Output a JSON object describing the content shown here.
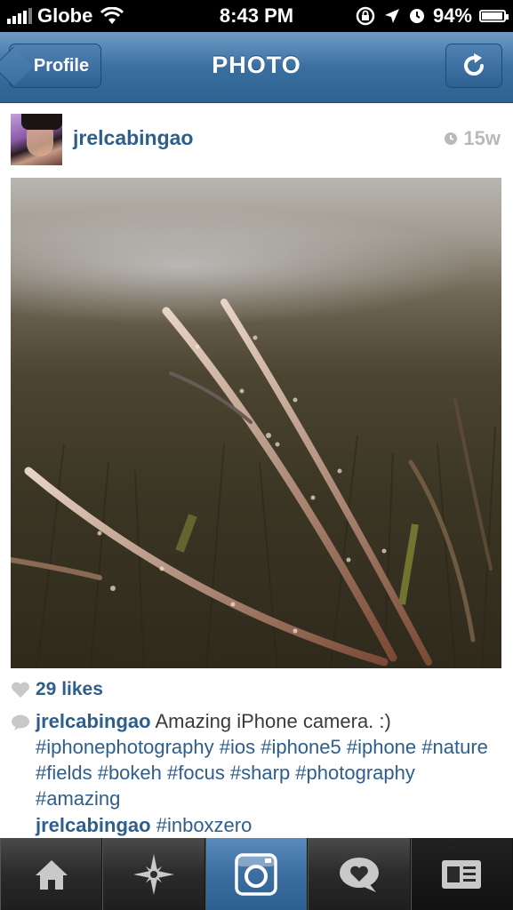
{
  "status_bar": {
    "carrier": "Globe",
    "time": "8:43 PM",
    "battery": "94%",
    "battery_level": 0.94
  },
  "nav": {
    "back_label": "Profile",
    "title": "PHOTO"
  },
  "post": {
    "username": "jrelcabingao",
    "timestamp": "15w",
    "likes": "29 likes",
    "caption_user": "jrelcabingao",
    "caption_text": "Amazing iPhone camera. :)",
    "caption_tags": "#iphonephotography #ios #iphone5 #iphone #nature #fields #bokeh #focus #sharp #photography #amazing",
    "comment_user": "jrelcabingao",
    "comment_text": "#inboxzero"
  },
  "tabs": [
    "home-icon",
    "explore-icon",
    "camera-icon",
    "activity-icon",
    "profile-icon"
  ],
  "colors": {
    "accent": "#2e5e8c",
    "navbar": "#3a6f9f",
    "tab_active": "#3c6ea0"
  }
}
